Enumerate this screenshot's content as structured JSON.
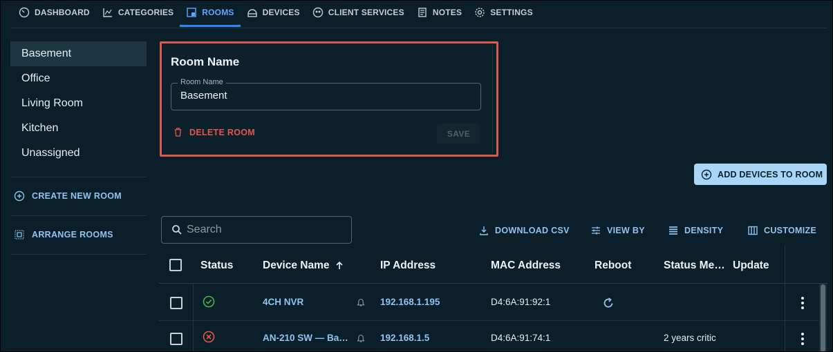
{
  "nav": {
    "tabs": [
      {
        "label": "DASHBOARD",
        "icon": "dashboard-icon"
      },
      {
        "label": "CATEGORIES",
        "icon": "chart-icon"
      },
      {
        "label": "ROOMS",
        "icon": "rooms-icon",
        "active": true
      },
      {
        "label": "DEVICES",
        "icon": "devices-icon"
      },
      {
        "label": "CLIENT SERVICES",
        "icon": "client-services-icon"
      },
      {
        "label": "NOTES",
        "icon": "notes-icon"
      },
      {
        "label": "SETTINGS",
        "icon": "gear-icon"
      }
    ]
  },
  "sidebar": {
    "rooms": [
      "Basement",
      "Office",
      "Living Room",
      "Kitchen",
      "Unassigned"
    ],
    "selected": "Basement",
    "create_label": "CREATE NEW ROOM",
    "arrange_label": "ARRANGE ROOMS"
  },
  "room_card": {
    "title": "Room Name",
    "field_label": "Room Name",
    "field_value": "Basement",
    "delete_label": "DELETE ROOM",
    "save_label": "SAVE"
  },
  "actions": {
    "add_devices_label": "ADD DEVICES TO ROOM"
  },
  "toolbar": {
    "search_placeholder": "Search",
    "download_label": "DOWNLOAD CSV",
    "view_by_label": "VIEW BY",
    "density_label": "DENSITY",
    "customize_label": "CUSTOMIZE"
  },
  "table": {
    "columns": [
      "Status",
      "Device Name",
      "IP Address",
      "MAC Address",
      "Reboot",
      "Status Me…",
      "Update"
    ],
    "sort_column": "Device Name",
    "sort_direction": "ascending",
    "rows": [
      {
        "status": "online",
        "device_name": "4CH NVR",
        "ip": "192.168.1.195",
        "mac": "D4:6A:91:92:1",
        "reboot": true,
        "status_message": ""
      },
      {
        "status": "error",
        "device_name": "AN-210 SW — Ba…",
        "ip": "192.168.1.5",
        "mac": "D4:6A:91:74:1",
        "reboot": false,
        "status_message": "2 years critic"
      }
    ]
  },
  "colors": {
    "background": "#0b1f2a",
    "accent": "#2b86f0",
    "link": "#8fc3f0",
    "danger": "#e0584c",
    "success": "#4caf50",
    "highlight_border": "#e0584c",
    "primary_button": "#a9d6f7"
  }
}
